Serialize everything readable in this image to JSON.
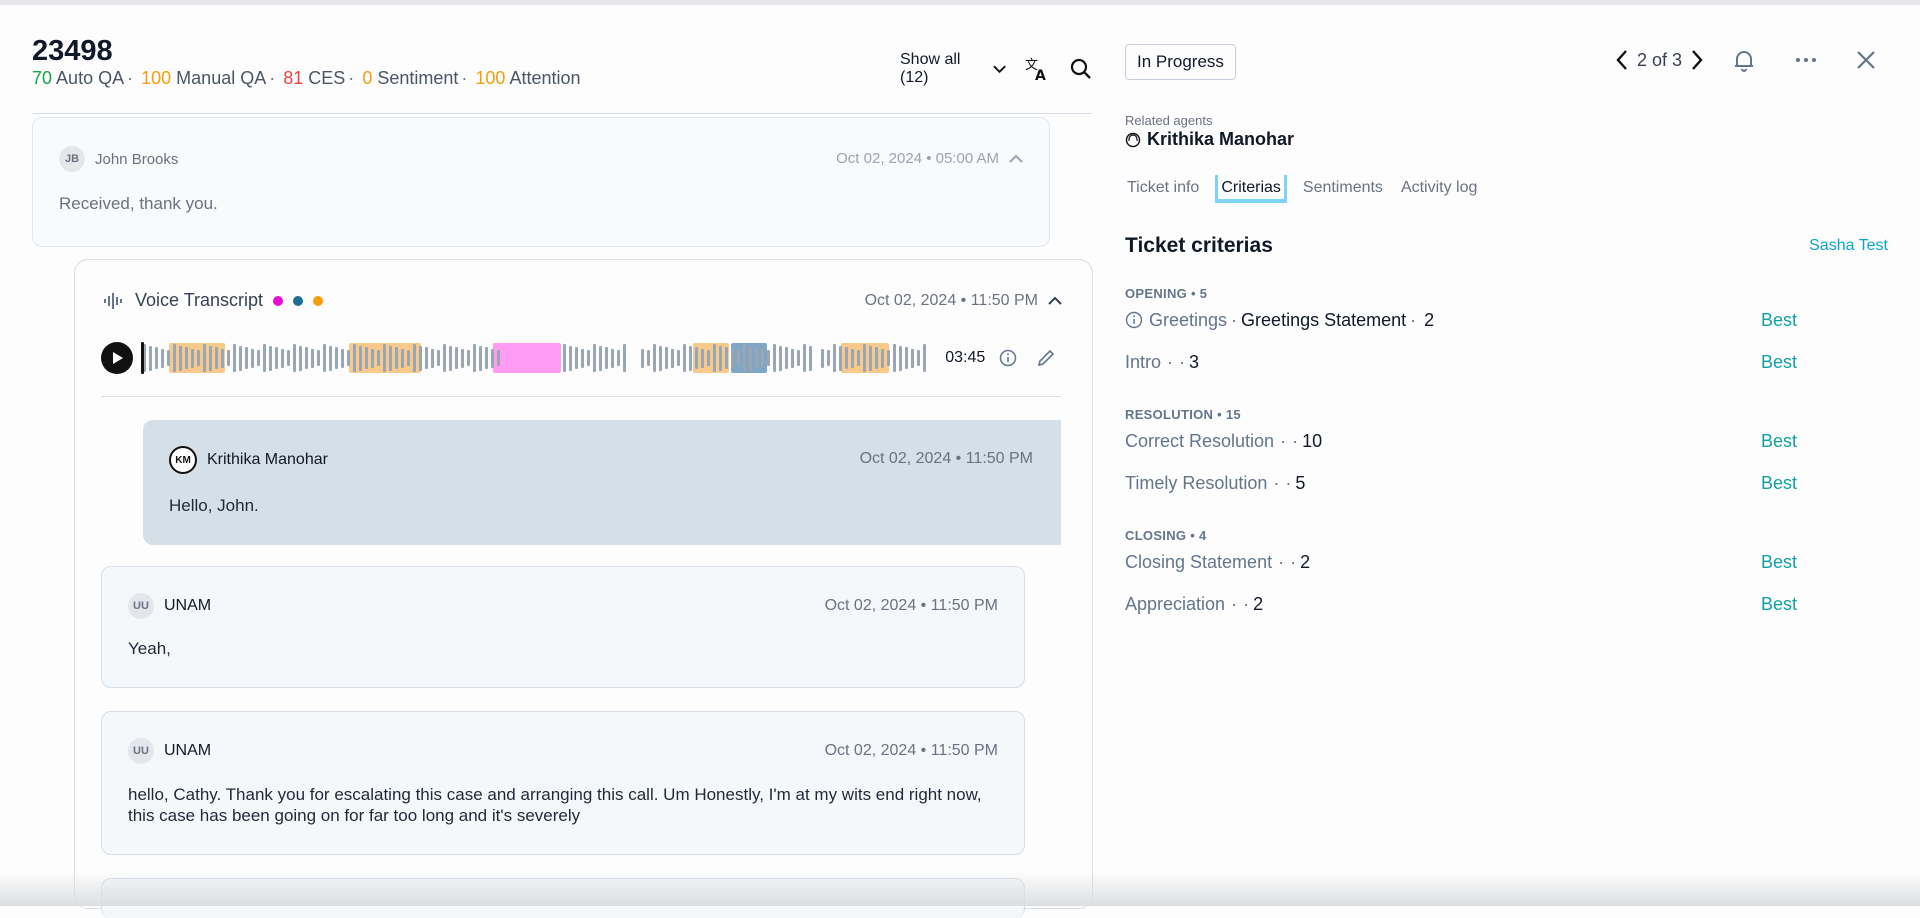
{
  "ticket": {
    "id": "23498",
    "scores": [
      {
        "value": "70",
        "label": "Auto QA",
        "color": "green"
      },
      {
        "value": "100",
        "label": "Manual QA",
        "color": "orange"
      },
      {
        "value": "81",
        "label": "CES",
        "color": "red"
      },
      {
        "value": "0",
        "label": "Sentiment",
        "color": "orange"
      },
      {
        "value": "100",
        "label": "Attention",
        "color": "orange"
      }
    ]
  },
  "toolbar": {
    "show_all": "Show all (12)"
  },
  "messages": {
    "john": {
      "initials": "JB",
      "name": "John Brooks",
      "time": "Oct 02, 2024 • 05:00 AM",
      "text": "Received, thank you."
    },
    "voice": {
      "title": "Voice Transcript",
      "time": "Oct 02, 2024 • 11:50 PM",
      "duration": "03:45",
      "dot_colors": [
        "#ec0ccf",
        "#1e6e96",
        "#f59e0b"
      ]
    },
    "km": {
      "initials": "KM",
      "name": "Krithika Manohar",
      "time": "Oct 02, 2024 • 11:50 PM",
      "text": "Hello, John."
    },
    "uu1": {
      "initials": "UU",
      "name": "UNAM",
      "time": "Oct 02, 2024 • 11:50 PM",
      "text": "Yeah,"
    },
    "uu2": {
      "initials": "UU",
      "name": "UNAM",
      "time": "Oct 02, 2024 • 11:50 PM",
      "text": "hello, Cathy. Thank you for escalating this case and arranging this call. Um Honestly, I'm at my wits end right now, this case has been going on for far too long and it's severely"
    }
  },
  "right": {
    "status": "In Progress",
    "pager": "2 of 3",
    "related_label": "Related agents",
    "related_agent": "Krithika Manohar",
    "tabs": [
      "Ticket info",
      "Criterias",
      "Sentiments",
      "Activity log"
    ],
    "active_tab": "Criterias",
    "criteria_title": "Ticket criterias",
    "user_link": "Sasha Test",
    "sections": [
      {
        "label": "OPENING • 5",
        "rows": [
          {
            "name": "Greetings",
            "extra": "Greetings Statement",
            "value": "2",
            "rating": "Best",
            "info": true
          },
          {
            "name": "Intro",
            "extra": "",
            "value": "3",
            "rating": "Best"
          }
        ]
      },
      {
        "label": "RESOLUTION • 15",
        "rows": [
          {
            "name": "Correct Resolution",
            "extra": "",
            "value": "10",
            "rating": "Best"
          },
          {
            "name": "Timely Resolution",
            "extra": "",
            "value": "5",
            "rating": "Best"
          }
        ]
      },
      {
        "label": "CLOSING • 4",
        "rows": [
          {
            "name": "Closing Statement",
            "extra": "",
            "value": "2",
            "rating": "Best"
          },
          {
            "name": "Appreciation",
            "extra": "",
            "value": "2",
            "rating": "Best"
          }
        ]
      }
    ]
  },
  "colors": {
    "accent_teal": "#14a0a0",
    "link": "#0ea5c6",
    "tab_highlight": "#7dd3fc"
  }
}
